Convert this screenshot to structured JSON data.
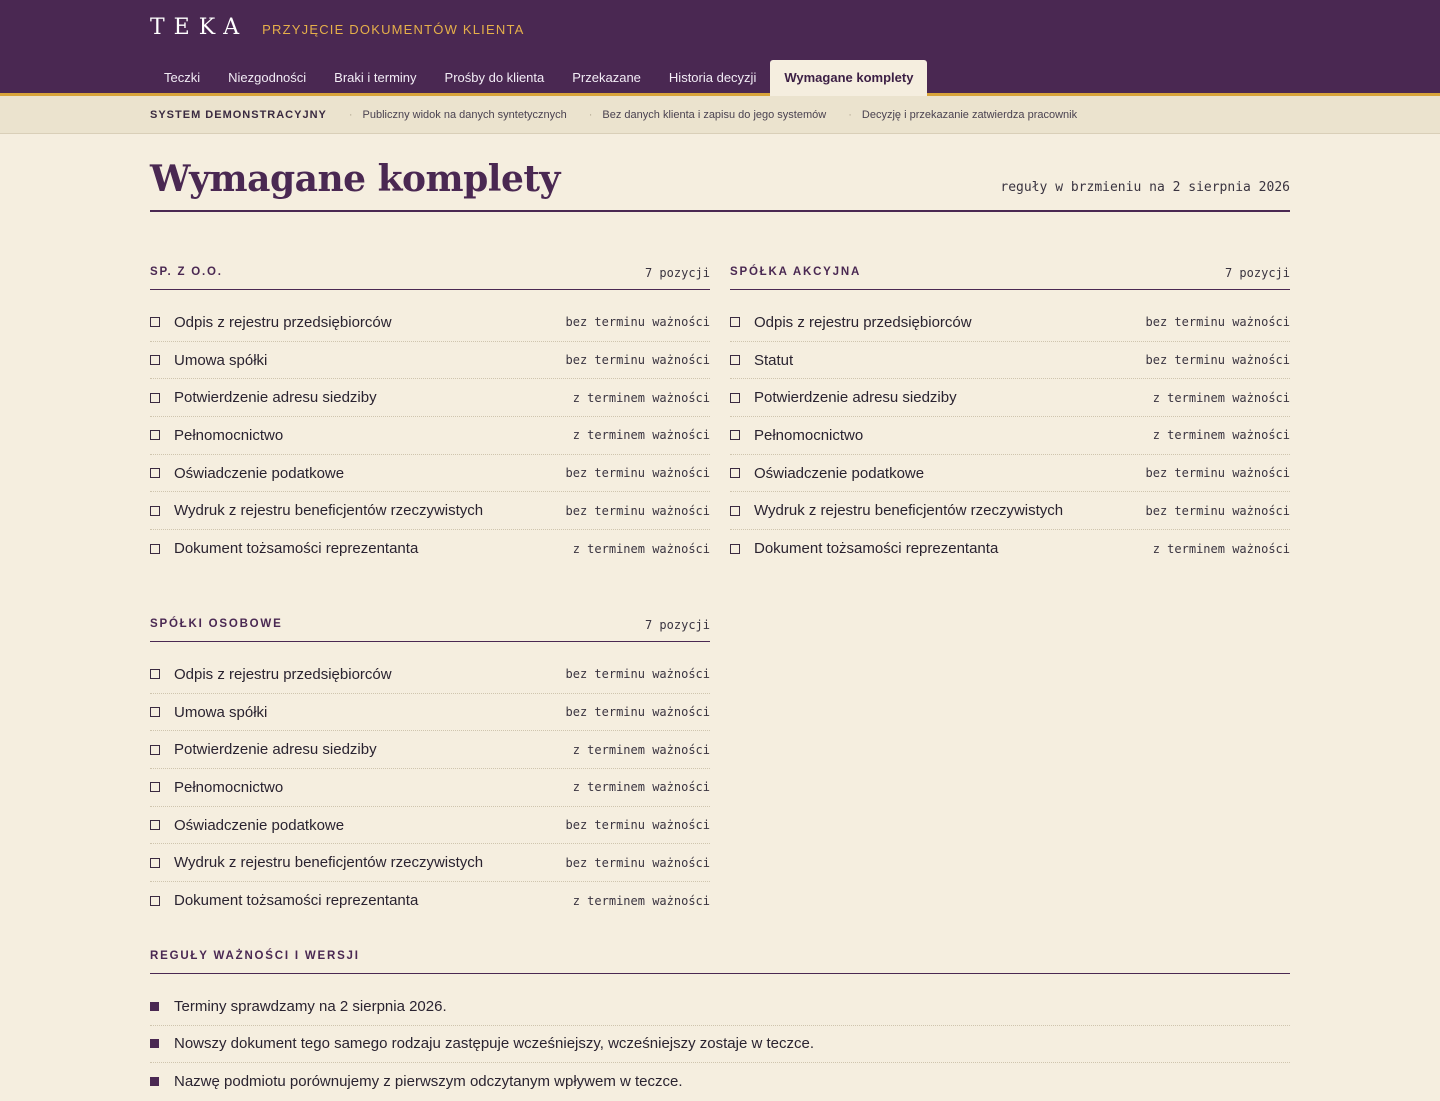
{
  "header": {
    "logo": "TEKA",
    "subtitle": "PRZYJĘCIE DOKUMENTÓW KLIENTA",
    "tabs": [
      {
        "label": "Teczki",
        "active": false
      },
      {
        "label": "Niezgodności",
        "active": false
      },
      {
        "label": "Braki i terminy",
        "active": false
      },
      {
        "label": "Prośby do klienta",
        "active": false
      },
      {
        "label": "Przekazane",
        "active": false
      },
      {
        "label": "Historia decyzji",
        "active": false
      },
      {
        "label": "Wymagane komplety",
        "active": true
      }
    ]
  },
  "infobar": {
    "system_label": "SYSTEM DEMONSTRACYJNY",
    "notes": [
      "Publiczny widok na danych syntetycznych",
      "Bez danych klienta i zapisu do jego systemów",
      "Decyzję i przekazanie zatwierdza pracownik"
    ]
  },
  "page": {
    "title": "Wymagane komplety",
    "rules_date": "reguły w brzmieniu na 2 sierpnia 2026"
  },
  "sections": [
    {
      "title": "SP. Z O.O.",
      "count": "7 pozycji",
      "items": [
        {
          "label": "Odpis z rejestru przedsiębiorców",
          "validity": "bez terminu ważności"
        },
        {
          "label": "Umowa spółki",
          "validity": "bez terminu ważności"
        },
        {
          "label": "Potwierdzenie adresu siedziby",
          "validity": "z terminem ważności"
        },
        {
          "label": "Pełnomocnictwo",
          "validity": "z terminem ważności"
        },
        {
          "label": "Oświadczenie podatkowe",
          "validity": "bez terminu ważności"
        },
        {
          "label": "Wydruk z rejestru beneficjentów rzeczywistych",
          "validity": "bez terminu ważności"
        },
        {
          "label": "Dokument tożsamości reprezentanta",
          "validity": "z terminem ważności"
        }
      ]
    },
    {
      "title": "SPÓŁKA AKCYJNA",
      "count": "7 pozycji",
      "items": [
        {
          "label": "Odpis z rejestru przedsiębiorców",
          "validity": "bez terminu ważności"
        },
        {
          "label": "Statut",
          "validity": "bez terminu ważności"
        },
        {
          "label": "Potwierdzenie adresu siedziby",
          "validity": "z terminem ważności"
        },
        {
          "label": "Pełnomocnictwo",
          "validity": "z terminem ważności"
        },
        {
          "label": "Oświadczenie podatkowe",
          "validity": "bez terminu ważności"
        },
        {
          "label": "Wydruk z rejestru beneficjentów rzeczywistych",
          "validity": "bez terminu ważności"
        },
        {
          "label": "Dokument tożsamości reprezentanta",
          "validity": "z terminem ważności"
        }
      ]
    },
    {
      "title": "SPÓŁKI OSOBOWE",
      "count": "7 pozycji",
      "items": [
        {
          "label": "Odpis z rejestru przedsiębiorców",
          "validity": "bez terminu ważności"
        },
        {
          "label": "Umowa spółki",
          "validity": "bez terminu ważności"
        },
        {
          "label": "Potwierdzenie adresu siedziby",
          "validity": "z terminem ważności"
        },
        {
          "label": "Pełnomocnictwo",
          "validity": "z terminem ważności"
        },
        {
          "label": "Oświadczenie podatkowe",
          "validity": "bez terminu ważności"
        },
        {
          "label": "Wydruk z rejestru beneficjentów rzeczywistych",
          "validity": "bez terminu ważności"
        },
        {
          "label": "Dokument tożsamości reprezentanta",
          "validity": "z terminem ważności"
        }
      ]
    }
  ],
  "rules": {
    "title": "REGUŁY WAŻNOŚCI I WERSJI",
    "items": [
      "Terminy sprawdzamy na 2 sierpnia 2026.",
      "Nowszy dokument tego samego rodzaju zastępuje wcześniejszy, wcześniejszy zostaje w teczce.",
      "Nazwę podmiotu porównujemy z pierwszym odczytanym wpływem w teczce."
    ]
  },
  "colors": {
    "header_bg": "#4a2852",
    "accent": "#d8a43a",
    "page_bg": "#f5eedf",
    "infobar_bg": "#ebe3ce"
  }
}
